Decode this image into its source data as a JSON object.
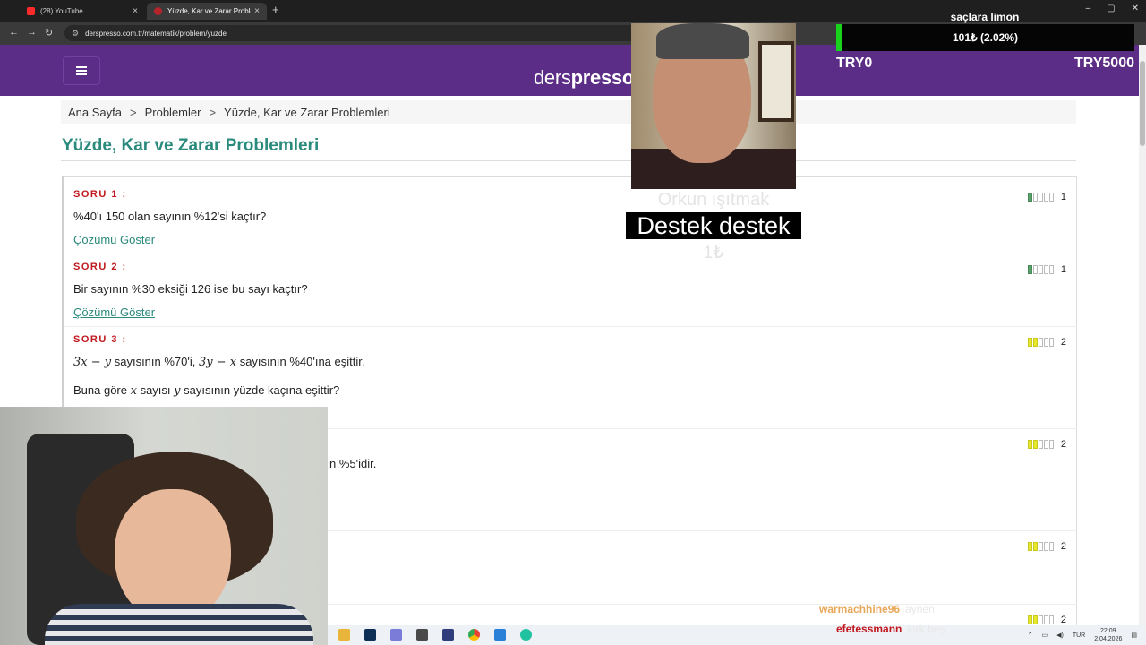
{
  "browser": {
    "tabs": [
      {
        "title": "(28) YouTube",
        "close": "×"
      },
      {
        "title": "Yüzde, Kar ve Zarar Problemleri",
        "close": "×"
      }
    ],
    "new_tab": "+",
    "window_controls": [
      "–",
      "▢",
      "✕"
    ],
    "nav": {
      "back": "←",
      "forward": "→",
      "reload": "↻"
    },
    "url": "derspresso.com.tr/matematik/problem/yuzde"
  },
  "site": {
    "logo_light": "ders",
    "logo_bold": "presso",
    "menu_icon": "hamburger-icon"
  },
  "breadcrumb": {
    "items": [
      "Ana Sayfa",
      "Problemler",
      "Yüzde, Kar ve Zarar Problemleri"
    ],
    "separator": ">"
  },
  "page_title": "Yüzde, Kar ve Zarar Problemleri",
  "questions": [
    {
      "label": "SORU 1 :",
      "text": "%40'ı 150 olan sayının %12'si kaçtır?",
      "link": "Çözümü Göster",
      "difficulty": 1,
      "color": "#5aa06a"
    },
    {
      "label": "SORU 2 :",
      "text": "Bir sayının %30 eksiği 126 ise bu sayı kaçtır?",
      "link": "Çözümü Göster",
      "difficulty": 1,
      "color": "#5aa06a"
    },
    {
      "label": "SORU 3 :",
      "line1": {
        "a": "3x − y",
        "b": " sayısının %70'i, ",
        "c": "3y − x",
        "d": " sayısının %40'ına eşittir."
      },
      "line2": {
        "a": "Buna göre ",
        "b": "x",
        "c": " sayısı ",
        "d": "y",
        "e": " sayısının yüzde kaçına eşittir?"
      },
      "difficulty": 2,
      "color": "#e8e82a"
    },
    {
      "fragment": "n %5'idir.",
      "difficulty": 2,
      "color": "#e8e82a"
    },
    {
      "difficulty": 2,
      "color": "#e8e82a"
    },
    {
      "difficulty": 2,
      "color": "#e8e82a"
    }
  ],
  "overlay": {
    "goal": {
      "title": "saçlara limon",
      "progress_text": "101₺ (2.02%)",
      "progress_percent": 2.02,
      "min_label": "TRY0",
      "max_label": "TRY5000"
    },
    "donation": {
      "name": "Orkun ışıtmak",
      "message": "Destek destek",
      "amount": "1₺"
    },
    "chat": [
      {
        "user": "warmachhine96",
        "message": "aynen"
      },
      {
        "user": "efetessmann",
        "message": "kırk beş"
      }
    ]
  },
  "taskbar": {
    "icons": [
      "file-explorer-icon",
      "photoshop-icon",
      "game-controller-icon",
      "minecraft-icon",
      "intellij-icon",
      "chrome-icon",
      "app-icon",
      "vpn-icon"
    ],
    "lang": "TUR",
    "time": "22:09",
    "date": "2.04.2026"
  },
  "colors": {
    "header_purple": "#5b2d86",
    "title_teal": "#2a8a7c",
    "label_red": "#c0181e",
    "goal_green": "#19d21c"
  }
}
